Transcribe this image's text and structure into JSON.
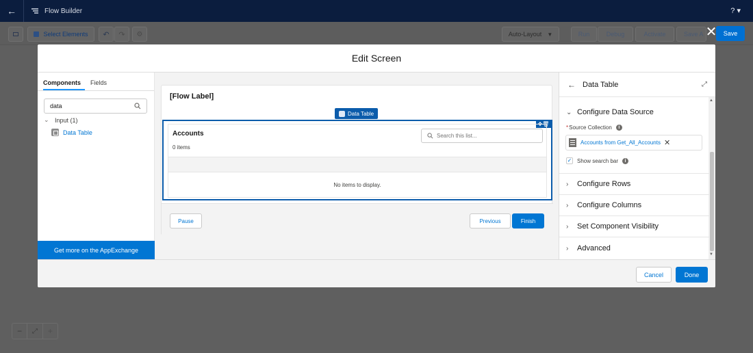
{
  "app": {
    "title": "Flow Builder",
    "help_label": "?"
  },
  "toolbar": {
    "select_elements_label": "Select Elements",
    "auto_layout_label": "Auto-Layout",
    "run_label": "Run",
    "debug_label": "Debug",
    "activate_label": "Activate",
    "save_as_label": "Save A",
    "save_label": "Save"
  },
  "modal": {
    "title": "Edit Screen",
    "close_label": "✕"
  },
  "left_panel": {
    "tabs": [
      "Components",
      "Fields"
    ],
    "search_value": "data",
    "group_label": "Input (1)",
    "item_label": "Data Table",
    "appexchange_label": "Get more on the AppExchange"
  },
  "canvas": {
    "flow_label": "[Flow Label]",
    "component_tag": "Data Table",
    "table": {
      "title": "Accounts",
      "count": "0 items",
      "search_placeholder": "Search this list...",
      "empty_text": "No items to display."
    },
    "buttons": {
      "pause": "Pause",
      "previous": "Previous",
      "finish": "Finish"
    }
  },
  "right_panel": {
    "title": "Data Table",
    "sections": {
      "configure_data_source": "Configure Data Source",
      "configure_rows": "Configure Rows",
      "configure_columns": "Configure Columns",
      "set_visibility": "Set Component Visibility",
      "advanced": "Advanced"
    },
    "source_collection_label": "Source Collection",
    "source_collection_value": "Accounts from Get_All_Accounts",
    "show_search_bar_label": "Show search bar"
  },
  "footer": {
    "cancel": "Cancel",
    "done": "Done"
  },
  "colors": {
    "brand": "#0176d3",
    "nav_dark": "#0b1d3e",
    "selection": "#0b5cab"
  }
}
